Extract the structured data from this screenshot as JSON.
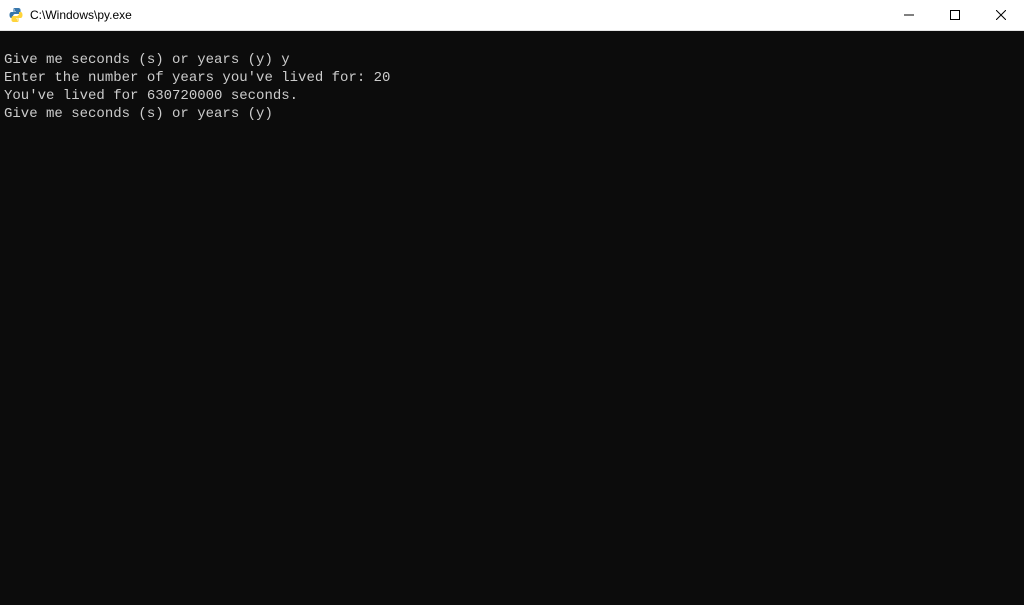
{
  "window": {
    "title": "C:\\Windows\\py.exe"
  },
  "terminal": {
    "lines": [
      "Give me seconds (s) or years (y) y",
      "Enter the number of years you've lived for: 20",
      "You've lived for 630720000 seconds.",
      "Give me seconds (s) or years (y)"
    ]
  }
}
